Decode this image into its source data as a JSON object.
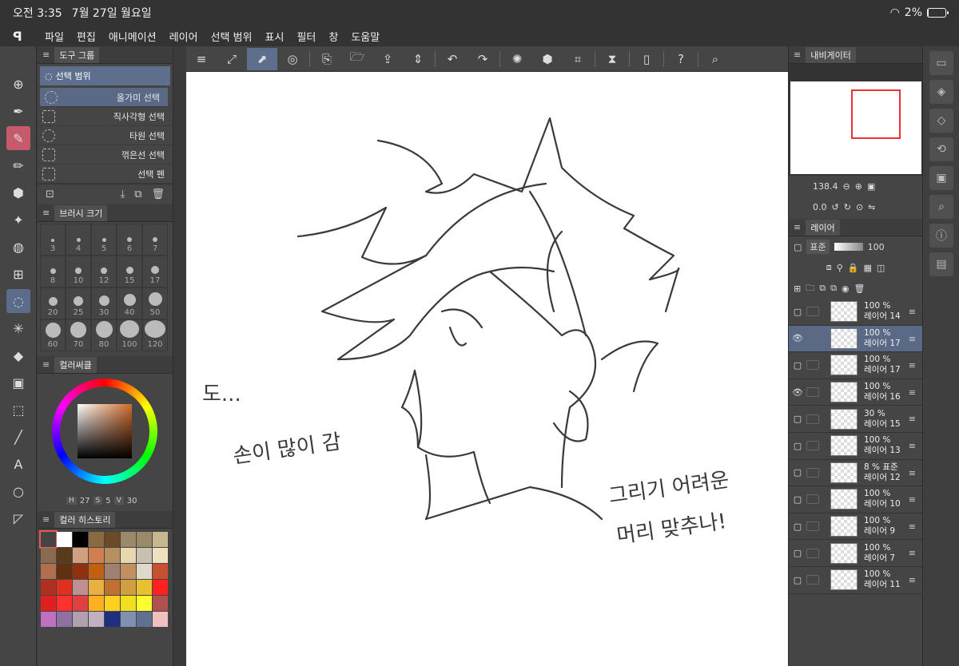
{
  "status": {
    "time": "오전 3:35",
    "date": "7월 27일 월요일",
    "battery": "2%",
    "battery_level": 0.02
  },
  "menu": {
    "logo": "ꟼ",
    "items": [
      "파일",
      "편집",
      "애니메이션",
      "레이어",
      "선택 범위",
      "표시",
      "필터",
      "창",
      "도움말"
    ]
  },
  "tools": [
    "move-icon",
    "pen-icon",
    "eraser-icon",
    "pencil-icon",
    "fill-icon",
    "sparkle-icon",
    "blend-icon",
    "grid-icon",
    "lasso-icon",
    "wand-icon",
    "bucket-icon",
    "gradient-icon",
    "cube-icon",
    "line-icon",
    "text-icon",
    "balloon-icon",
    "ruler-icon"
  ],
  "subtool": {
    "tab": "도구 그룹",
    "group_title": "선택 범위",
    "items": [
      "올가미 선택",
      "직사각형 선택",
      "타원 선택",
      "꺾은선 선택",
      "선택 펜"
    ]
  },
  "brush": {
    "tab": "브러시 크기",
    "sizes": [
      "3",
      "4",
      "5",
      "6",
      "7",
      "8",
      "10",
      "12",
      "15",
      "17",
      "20",
      "25",
      "30",
      "40",
      "50",
      "60",
      "70",
      "80",
      "100",
      "120"
    ]
  },
  "color": {
    "tab": "컬러써클",
    "h_label": "H",
    "h": "27",
    "s_label": "S",
    "s": "5",
    "v_label": "V",
    "v": "30"
  },
  "history": {
    "tab": "컬러 히스토리",
    "swatches": [
      "#444444",
      "#ffffff",
      "#000000",
      "#8a6a40",
      "#6b4a2a",
      "#9a8a6a",
      "#9a8a6a",
      "#c8b890",
      "#8a6a50",
      "#5a3a1a",
      "#d0a080",
      "#d08050",
      "#b89060",
      "#e8d8b0",
      "#c8c0b0",
      "#f0e0c0",
      "#b07050",
      "#603010",
      "#903010",
      "#c06010",
      "#a08070",
      "#c09060",
      "#e0d8c8",
      "#c85030",
      "#b03020",
      "#e03020",
      "#c09090",
      "#e8b040",
      "#c07030",
      "#d0a040",
      "#e8c030",
      "#ff2020",
      "#e02020",
      "#ff3030",
      "#e04040",
      "#ffb020",
      "#ffd020",
      "#f0e020",
      "#ffff30",
      "#b05050",
      "#c070c0",
      "#9070a0",
      "#b0a0b0",
      "#c0b0c0",
      "#203080",
      "#8090b0",
      "#607090",
      "#f0c0c0"
    ]
  },
  "toolbar": [
    "menu-icon",
    "fit-icon",
    "selection-icon",
    "cloud-icon",
    "new-icon",
    "open-icon",
    "save-icon",
    "updown-icon",
    "undo-icon",
    "redo-icon",
    "spinner-icon",
    "fill-icon",
    "crop-icon",
    "flip-icon",
    "phone-icon",
    "help-icon",
    "search-icon"
  ],
  "navigator": {
    "tab": "내비게이터",
    "zoom": "138.4",
    "rotation": "0.0"
  },
  "layers": {
    "tab": "레이어",
    "blend": "표준",
    "opacity": "100",
    "rows": [
      {
        "opacity": "100 %",
        "name": "레이어 14",
        "eye": false,
        "selected": false
      },
      {
        "opacity": "100 %",
        "name": "레이어 17",
        "eye": true,
        "selected": true
      },
      {
        "opacity": "100 %",
        "name": "레이어 17",
        "eye": false,
        "selected": false
      },
      {
        "opacity": "100 %",
        "name": "레이어 16",
        "eye": true,
        "selected": false
      },
      {
        "opacity": "30 %",
        "name": "레이어 15",
        "eye": false,
        "selected": false
      },
      {
        "opacity": "100 %",
        "name": "레이어 13",
        "eye": false,
        "selected": false
      },
      {
        "opacity": "8 % 표준",
        "name": "레이어 12",
        "eye": false,
        "selected": false
      },
      {
        "opacity": "100 %",
        "name": "레이어 10",
        "eye": false,
        "selected": false
      },
      {
        "opacity": "100 %",
        "name": "레이어 9",
        "eye": false,
        "selected": false
      },
      {
        "opacity": "100 %",
        "name": "레이어 7",
        "eye": false,
        "selected": false
      },
      {
        "opacity": "100 %",
        "name": "레이어 11",
        "eye": false,
        "selected": false
      }
    ]
  },
  "canvas_text": {
    "note1": "도...",
    "note2": "손이 많이 감",
    "note3": "그리기 어려운",
    "note4": "머리 맞추나!"
  }
}
